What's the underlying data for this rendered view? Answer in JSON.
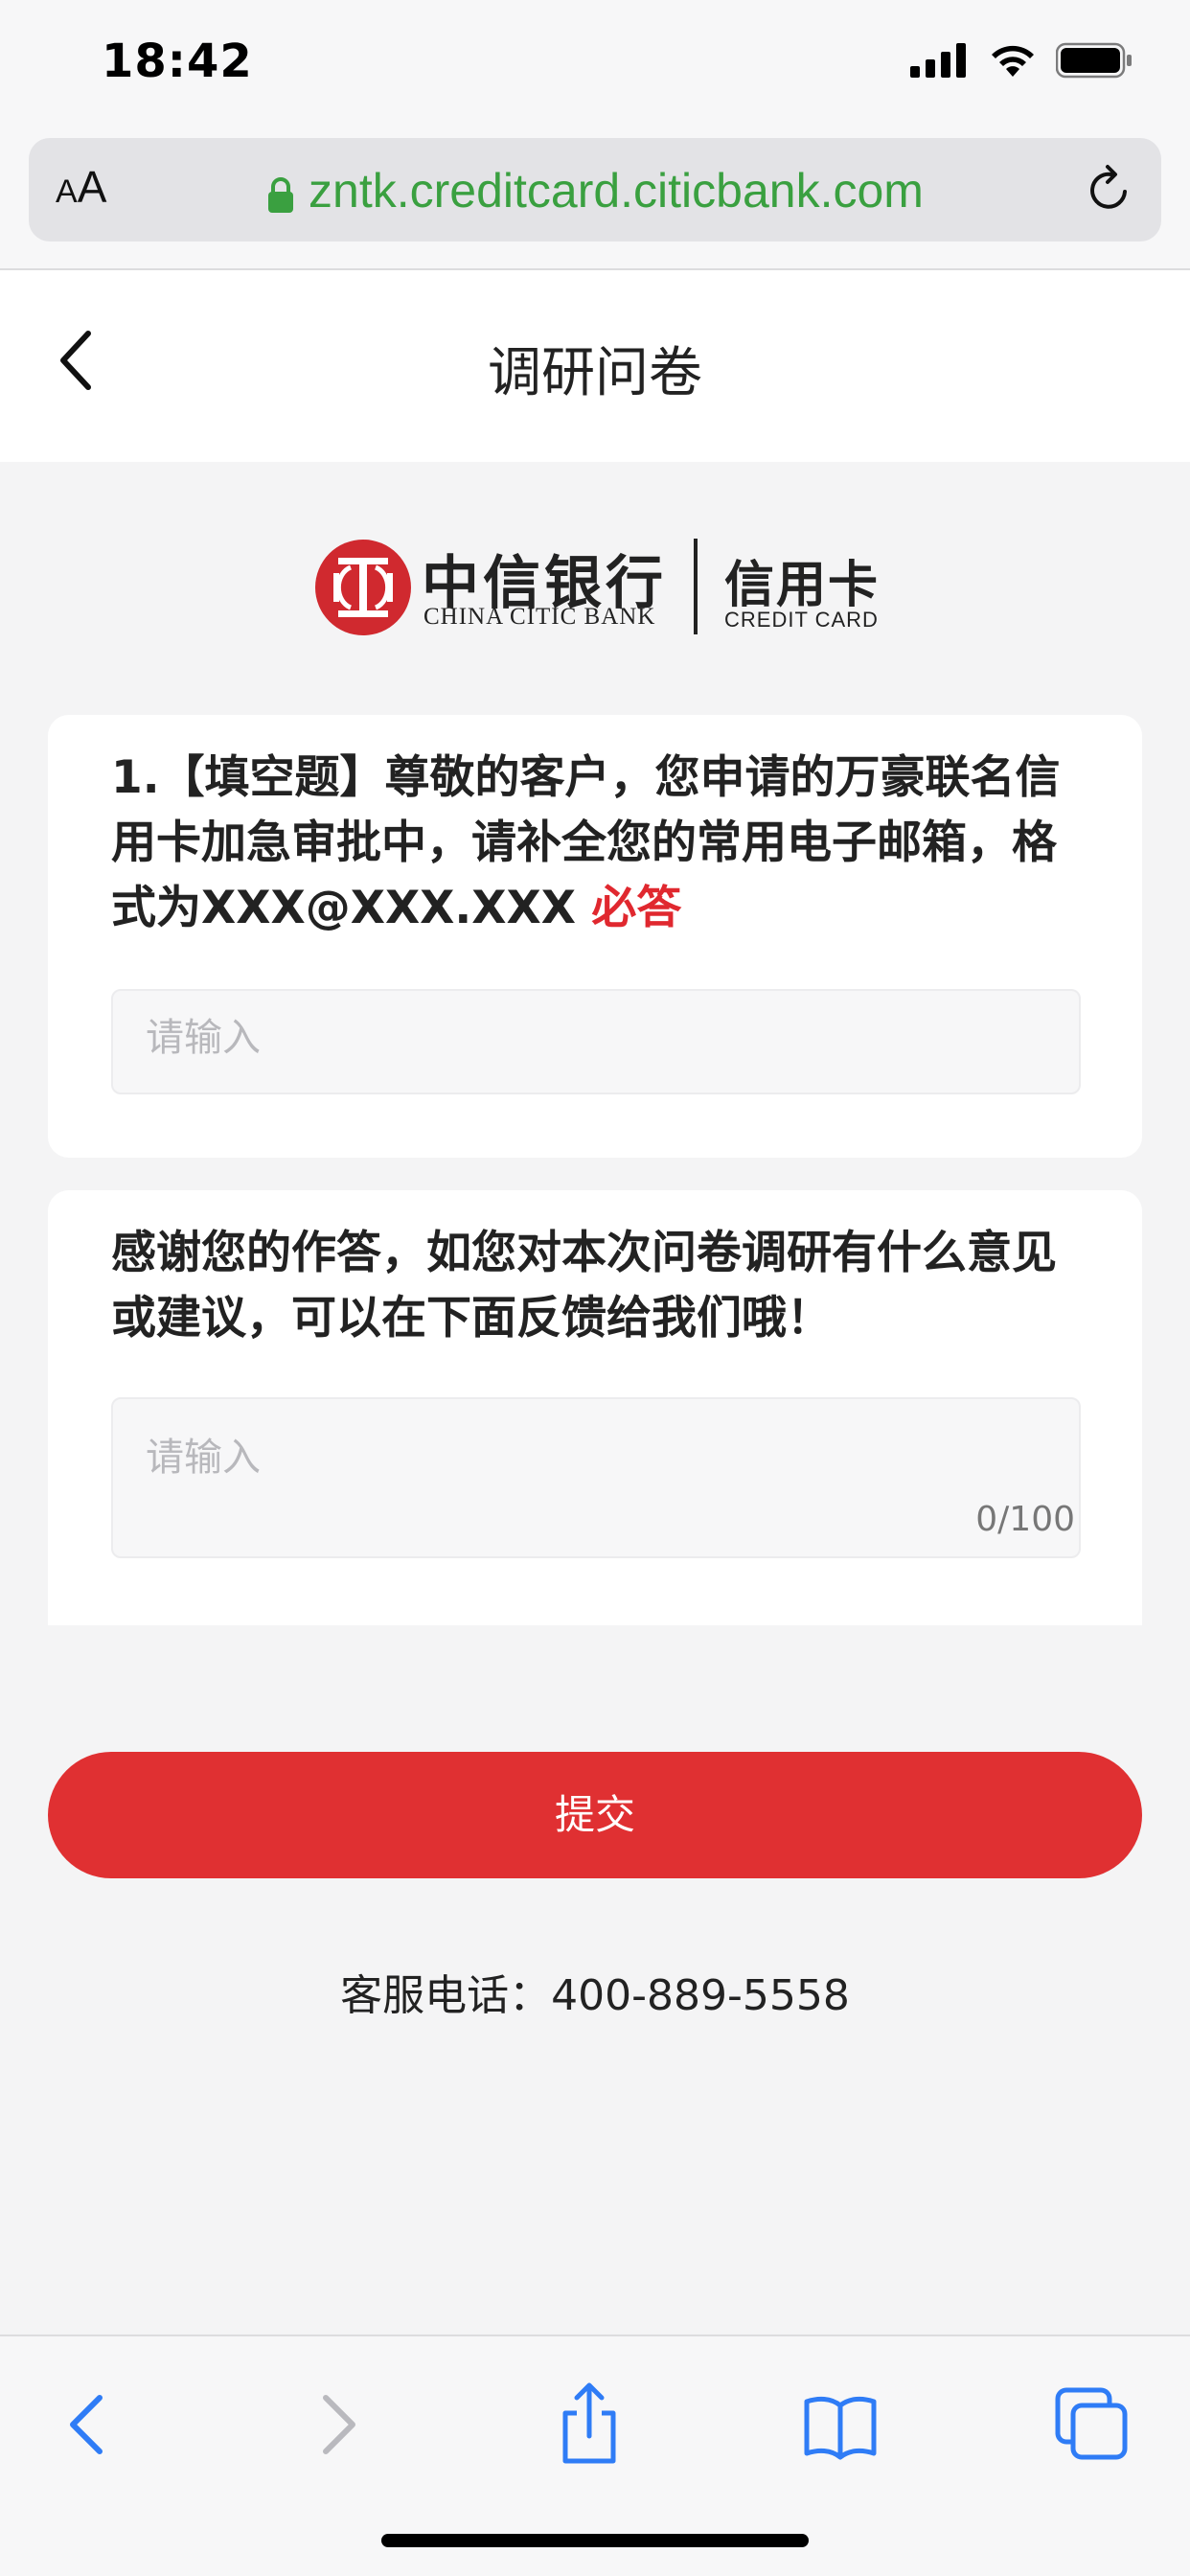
{
  "status_bar": {
    "time": "18:42"
  },
  "browser": {
    "text_size_label_small": "A",
    "text_size_label_large": "A",
    "url": "zntk.creditcard.citicbank.com"
  },
  "header": {
    "title": "调研问卷"
  },
  "logo": {
    "name_cn": "中信银行",
    "name_en": "CHINA CITIC BANK",
    "product_cn": "信用卡",
    "product_en": "CREDIT CARD",
    "brand_color": "#d0292f"
  },
  "questions": [
    {
      "text": "1.【填空题】尊敬的客户，您申请的万豪联名信用卡加急审批中，请补全您的常用电子邮箱，格式为XXX@XXX.XXX",
      "required_label": "必答",
      "placeholder": "请输入",
      "value": ""
    }
  ],
  "feedback": {
    "text": "感谢您的作答，如您对本次问卷调研有什么意见或建议，可以在下面反馈给我们哦！",
    "placeholder": "请输入",
    "counter": "0/100"
  },
  "submit": {
    "label": "提交",
    "color": "#e03032"
  },
  "service": {
    "text": "客服电话：400-889-5558"
  },
  "colors": {
    "accent_blue": "#2f7cf6",
    "url_green": "#3aa040",
    "required_red": "#e0282f"
  }
}
